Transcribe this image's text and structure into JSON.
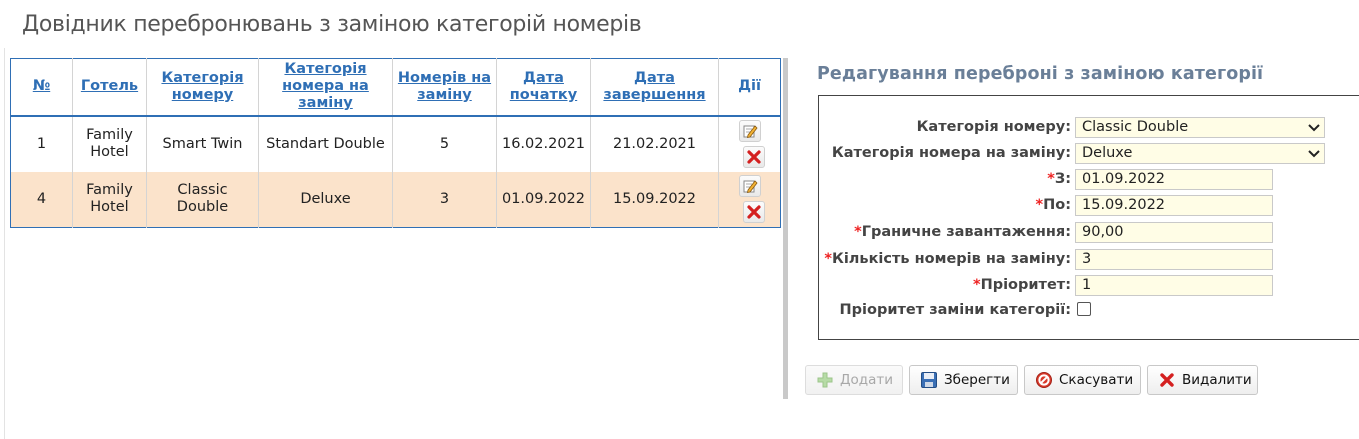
{
  "page": {
    "title": "Довідник перебронювань з заміною категорій номерів"
  },
  "table": {
    "columns": [
      "№",
      "Готель",
      "Категорія номеру",
      "Категорія номера на заміну",
      "Номерів на заміну",
      "Дата початку",
      "Дата завершення",
      "Дії"
    ],
    "rows": [
      {
        "num": "1",
        "hotel": "Family Hotel",
        "category": "Smart Twin",
        "replacement": "Standart Double",
        "rooms": "5",
        "start": "16.02.2021",
        "end": "21.02.2021",
        "selected": false
      },
      {
        "num": "4",
        "hotel": "Family Hotel",
        "category": "Classic Double",
        "replacement": "Deluxe",
        "rooms": "3",
        "start": "01.09.2022",
        "end": "15.09.2022",
        "selected": true
      }
    ],
    "row_icons": {
      "edit": "edit-icon",
      "delete": "delete-icon"
    }
  },
  "editor": {
    "title": "Редагування переброні з заміною категорії",
    "fields": {
      "category": {
        "label": "Категорія номеру:",
        "value": "Classic Double"
      },
      "replacement": {
        "label": "Категорія номера на заміну:",
        "value": "Deluxe"
      },
      "from": {
        "required": "*",
        "label": "З:",
        "value": "01.09.2022"
      },
      "to": {
        "required": "*",
        "label": "По:",
        "value": "15.09.2022"
      },
      "load": {
        "required": "*",
        "label": "Граничне завантаження:",
        "value": "90,00"
      },
      "rooms": {
        "required": "*",
        "label": "Кількість номерів на заміну:",
        "value": "3"
      },
      "priority": {
        "required": "*",
        "label": "Пріоритет:",
        "value": "1"
      },
      "replace_priority": {
        "label": "Пріоритет заміни категорії:",
        "checked": false
      }
    }
  },
  "buttons": {
    "add": "Додати",
    "save": "Зберегти",
    "cancel": "Скасувати",
    "delete": "Видалити"
  },
  "colors": {
    "accent": "#2f6fb5",
    "selected_row": "#fbe3cb",
    "required": "#e22222",
    "input_bg": "#fffde6"
  }
}
